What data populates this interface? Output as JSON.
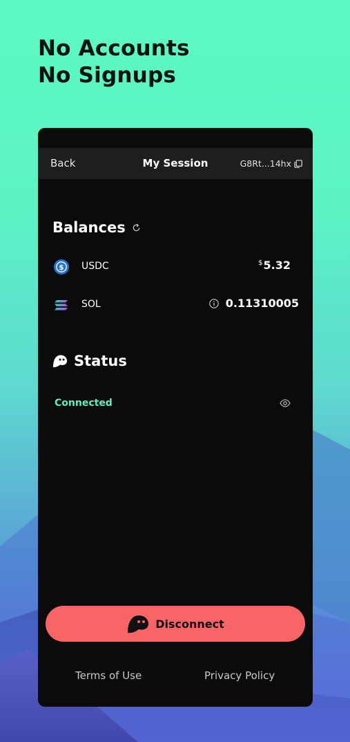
{
  "headline": {
    "line1_bold": "No",
    "line1_rest": "Accounts",
    "line2_bold": "No",
    "line2_rest": "Signups"
  },
  "navbar": {
    "back_label": "Back",
    "title": "My Session",
    "address": "G8Rt...14hx"
  },
  "balances": {
    "title": "Balances",
    "tokens": [
      {
        "name": "USDC",
        "currency_symbol": "$",
        "amount": "5.32",
        "icon": "usdc-icon"
      },
      {
        "name": "SOL",
        "amount": "0.11310005",
        "icon": "solana-icon"
      }
    ]
  },
  "status": {
    "title": "Status",
    "value": "Connected"
  },
  "disconnect_label": "Disconnect",
  "footer": {
    "terms": "Terms of Use",
    "privacy": "Privacy Policy"
  },
  "colors": {
    "background_top": "#5df8c3",
    "card": "#0b0b0b",
    "navbar": "#1e1e1e",
    "accent_green": "#5ef0c2",
    "disconnect_button": "#f96566"
  }
}
